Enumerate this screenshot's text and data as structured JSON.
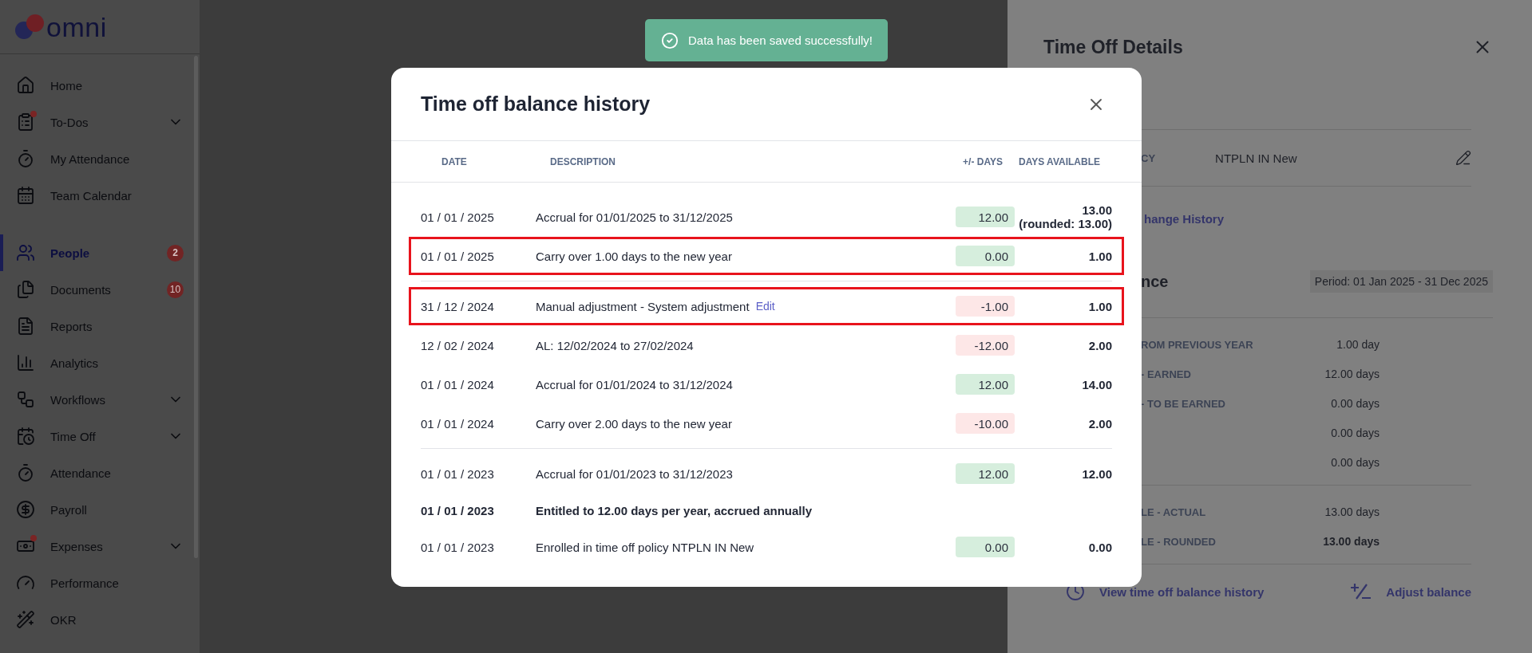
{
  "sidebar": {
    "logo": "omni",
    "sections": [
      [
        {
          "label": "Home",
          "expandable": false,
          "selected": false,
          "notification": false
        },
        {
          "label": "To-Dos",
          "expandable": true,
          "selected": false,
          "notification": true
        },
        {
          "label": "My Attendance",
          "expandable": false,
          "selected": false,
          "notification": false
        },
        {
          "label": "Team Calendar",
          "expandable": false,
          "selected": false,
          "notification": false
        }
      ],
      [
        {
          "label": "People",
          "expandable": false,
          "selected": true,
          "notification": false,
          "badge": "2"
        },
        {
          "label": "Documents",
          "expandable": false,
          "selected": false,
          "notification": false,
          "badge": "10"
        },
        {
          "label": "Reports",
          "expandable": false,
          "selected": false,
          "notification": false
        },
        {
          "label": "Analytics",
          "expandable": false,
          "selected": false,
          "notification": false
        },
        {
          "label": "Workflows",
          "expandable": true,
          "selected": false,
          "notification": false
        },
        {
          "label": "Time Off",
          "expandable": true,
          "selected": false,
          "notification": false
        },
        {
          "label": "Attendance",
          "expandable": false,
          "selected": false,
          "notification": false
        },
        {
          "label": "Payroll",
          "expandable": false,
          "selected": false,
          "notification": false
        },
        {
          "label": "Expenses",
          "expandable": true,
          "selected": false,
          "notification": true
        },
        {
          "label": "Performance",
          "expandable": false,
          "selected": false,
          "notification": false
        },
        {
          "label": "OKR",
          "expandable": false,
          "selected": false,
          "notification": false
        }
      ]
    ]
  },
  "toast": {
    "message": "Data has been saved successfully!"
  },
  "drawer": {
    "title": "Time Off Details",
    "policy": {
      "label": "CY",
      "value": "NTPLN IN New"
    },
    "link": "hange History",
    "section": {
      "title": "nce",
      "period": "Period: 01 Jan 2025 - 31 Dec 2025"
    },
    "balances": [
      {
        "label": "ROM PREVIOUS YEAR",
        "value": "1.00 day",
        "bold": false
      },
      {
        "label": "- EARNED",
        "value": "12.00 days",
        "bold": false
      },
      {
        "label": "- TO BE EARNED",
        "value": "0.00 days",
        "bold": false
      },
      {
        "value": "0.00 days",
        "bold": false
      },
      {
        "value": "0.00 days",
        "bold": false
      }
    ],
    "totals": [
      {
        "label": "LE - ACTUAL",
        "value": "13.00 days",
        "bold": false
      },
      {
        "label": "LE - ROUNDED",
        "value": "13.00 days",
        "bold": true
      }
    ],
    "actions": [
      {
        "label": "View time off balance history",
        "kind": "history"
      },
      {
        "label": "Adjust balance",
        "kind": "adjust"
      }
    ]
  },
  "modal": {
    "title": "Time off balance history",
    "columns": [
      "DATE",
      "DESCRIPTION",
      "+/- DAYS",
      "DAYS AVAILABLE"
    ],
    "groups": [
      [
        {
          "date": "01 / 01 / 2025",
          "description": "Accrual for 01/01/2025 to 31/12/2025",
          "days": "12.00",
          "kind": "credit",
          "available": "13.00",
          "available_rounded": "(rounded: 13.00)",
          "highlighted": false,
          "bold": false
        },
        {
          "date": "01 / 01 / 2025",
          "description": "Carry over 1.00 days to the new year",
          "days": "0.00",
          "kind": "credit",
          "available": "1.00",
          "highlighted": true,
          "bold": false
        }
      ],
      [
        {
          "date": "31 / 12 / 2024",
          "description": "Manual adjustment - System adjustment",
          "edit": "Edit",
          "days": "-1.00",
          "kind": "debit",
          "available": "1.00",
          "highlighted": true,
          "bold": false
        },
        {
          "date": "12 / 02 / 2024",
          "description": "AL: 12/02/2024 to 27/02/2024",
          "days": "-12.00",
          "kind": "debit",
          "available": "2.00",
          "highlighted": false,
          "bold": false
        },
        {
          "date": "01 / 01 / 2024",
          "description": "Accrual for 01/01/2024 to 31/12/2024",
          "days": "12.00",
          "kind": "credit",
          "available": "14.00",
          "highlighted": false,
          "bold": false
        },
        {
          "date": "01 / 01 / 2024",
          "description": "Carry over 2.00 days to the new year",
          "days": "-10.00",
          "kind": "debit",
          "available": "2.00",
          "highlighted": false,
          "bold": false
        }
      ],
      [
        {
          "date": "01 / 01 / 2023",
          "description": "Accrual for 01/01/2023 to 31/12/2023",
          "days": "12.00",
          "kind": "credit",
          "available": "12.00",
          "highlighted": false,
          "bold": false
        },
        {
          "date": "01 / 01 / 2023",
          "description": "Entitled to 12.00 days per year, accrued annually",
          "kind": "note",
          "highlighted": false,
          "bold": true
        },
        {
          "date": "01 / 01 / 2023",
          "description": "Enrolled in time off policy NTPLN IN New",
          "days": "0.00",
          "kind": "credit",
          "available": "0.00",
          "highlighted": false,
          "bold": false
        }
      ]
    ]
  }
}
